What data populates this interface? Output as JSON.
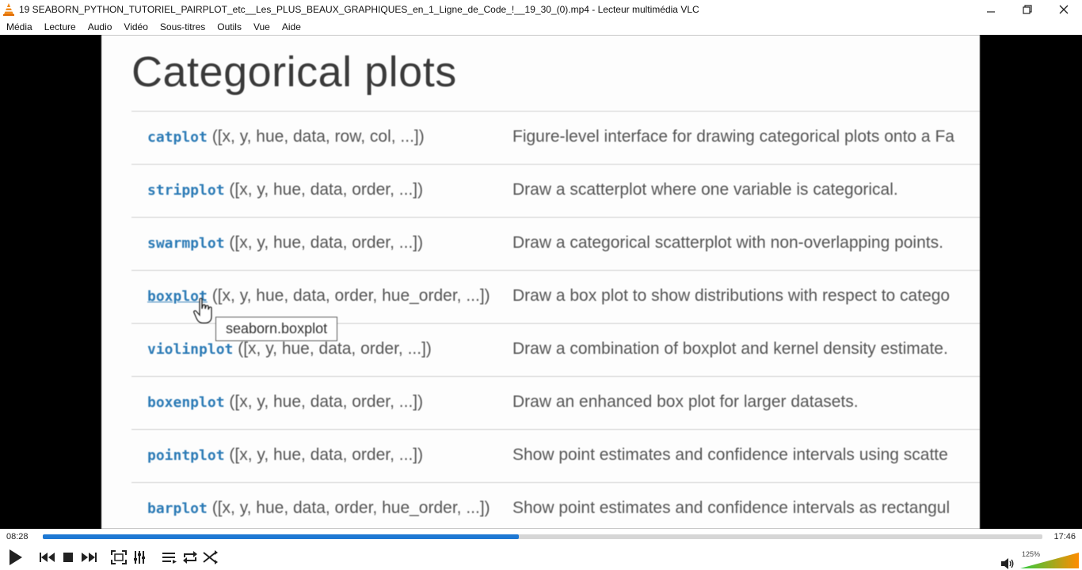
{
  "window": {
    "title": "19 SEABORN_PYTHON_TUTORIEL_PAIRPLOT_etc__Les_PLUS_BEAUX_GRAPHIQUES_en_1_Ligne_de_Code_!__19_30_(0).mp4 - Lecteur multimédia VLC",
    "controls": [
      "minimize-icon",
      "maximize-icon",
      "close-icon"
    ]
  },
  "menu": {
    "items": [
      "Média",
      "Lecture",
      "Audio",
      "Vidéo",
      "Sous-titres",
      "Outils",
      "Vue",
      "Aide"
    ]
  },
  "video": {
    "heading": "Categorical plots",
    "rows": [
      {
        "fn": "catplot",
        "args": " ([x, y, hue, data, row, col, ...])",
        "desc": "Figure-level interface for drawing categorical plots onto a Fa"
      },
      {
        "fn": "stripplot",
        "args": " ([x, y, hue, data, order, ...])",
        "desc": "Draw a scatterplot where one variable is categorical."
      },
      {
        "fn": "swarmplot",
        "args": " ([x, y, hue, data, order, ...])",
        "desc": "Draw a categorical scatterplot with non-overlapping points."
      },
      {
        "fn": "boxplot",
        "args": " ([x, y, hue, data, order, hue_order, ...])",
        "desc": "Draw a box plot to show distributions with respect to catego"
      },
      {
        "fn": "violinplot",
        "args": " ([x, y, hue, data, order, ...])",
        "desc": "Draw a combination of boxplot and kernel density estimate."
      },
      {
        "fn": "boxenplot",
        "args": " ([x, y, hue, data, order, ...])",
        "desc": "Draw an enhanced box plot for larger datasets."
      },
      {
        "fn": "pointplot",
        "args": " ([x, y, hue, data, order, ...])",
        "desc": "Show point estimates and confidence intervals using scatte"
      },
      {
        "fn": "barplot",
        "args": " ([x, y, hue, data, order, hue_order, ...])",
        "desc": "Show point estimates and confidence intervals as rectangul"
      }
    ],
    "tooltip": "seaborn.boxplot"
  },
  "player": {
    "current_time": "08:28",
    "total_time": "17:46",
    "progress_fraction": 0.476,
    "volume_text": "125%",
    "volume_fraction": 1.0,
    "accent_color": "#1e78d3",
    "volume_color_low": "#2ecc40",
    "volume_color_high": "#ff8c00",
    "buttons": [
      "play-icon",
      "previous-icon",
      "stop-icon",
      "next-icon",
      "fullscreen-icon",
      "extended-settings-icon",
      "playlist-icon",
      "loop-icon",
      "shuffle-icon"
    ]
  }
}
